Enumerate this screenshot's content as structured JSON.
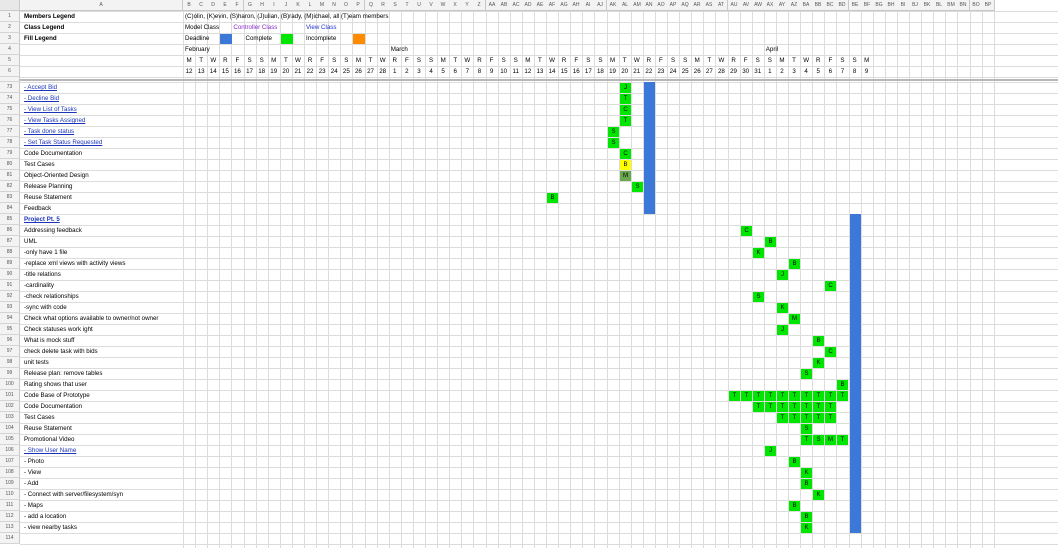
{
  "sheet": {
    "column_headers": [
      "A",
      "B",
      "C",
      "D",
      "E",
      "F",
      "G",
      "H",
      "I",
      "J",
      "K",
      "L",
      "M",
      "N",
      "O",
      "P",
      "Q",
      "R",
      "S",
      "T",
      "U",
      "V",
      "W",
      "X",
      "Y",
      "Z",
      "AA",
      "AB",
      "AC",
      "AD",
      "AE",
      "AF",
      "AG",
      "AH",
      "AI",
      "AJ",
      "AK",
      "AL",
      "AM",
      "AN",
      "AO",
      "AP",
      "AQ",
      "AR",
      "AS",
      "AT",
      "AU",
      "AV",
      "AW",
      "AX",
      "AY",
      "AZ",
      "BA",
      "BB",
      "BC",
      "BD",
      "BE",
      "BF",
      "BG",
      "BH",
      "BI",
      "BJ",
      "BK",
      "BL",
      "BM",
      "BN",
      "BO",
      "BP"
    ],
    "row_numbers": [
      "1",
      "2",
      "3",
      "4",
      "5",
      "6",
      "73",
      "74",
      "75",
      "76",
      "77",
      "78",
      "79",
      "80",
      "81",
      "82",
      "83",
      "84",
      "85",
      "86",
      "87",
      "88",
      "89",
      "90",
      "91",
      "92",
      "93",
      "94",
      "95",
      "96",
      "97",
      "98",
      "99",
      "100",
      "101",
      "102",
      "103",
      "104",
      "105",
      "106",
      "107",
      "108",
      "109",
      "110",
      "111",
      "112",
      "113",
      "114"
    ]
  },
  "legend": {
    "members_label": "Members Legend",
    "members_text": "(C)olin, (K)evin, (S)haron, (J)ulian, (B)rady, (M)ichael, all (T)eam members",
    "class_label": "Class Legend",
    "class_items": [
      "Model Class",
      "Controller Class",
      "View Class"
    ],
    "fill_label": "Fill Legend",
    "fill_items": [
      "Deadline",
      "Complete",
      "Incomplete"
    ]
  },
  "colors": {
    "deadline": "#3c78d8",
    "complete": "#00e600",
    "incomplete": "#ff8c00",
    "yellow": "#ffff00",
    "olive": "#6aa84f"
  },
  "months": [
    "February",
    "March",
    "April"
  ],
  "weekdays": [
    "M",
    "T",
    "W",
    "R",
    "F",
    "S",
    "S",
    "M",
    "T",
    "W",
    "R",
    "F",
    "S",
    "S",
    "M",
    "T",
    "W",
    "R",
    "F",
    "S",
    "S",
    "M",
    "T",
    "W",
    "R",
    "F",
    "S",
    "S",
    "M",
    "T",
    "W",
    "R",
    "F",
    "S",
    "S",
    "M",
    "T",
    "W",
    "R",
    "F",
    "S",
    "S",
    "M",
    "T",
    "W",
    "R",
    "F",
    "S",
    "S",
    "M",
    "T",
    "W",
    "R",
    "F",
    "S",
    "S",
    "M"
  ],
  "dates": [
    "12",
    "13",
    "14",
    "15",
    "16",
    "17",
    "18",
    "19",
    "20",
    "21",
    "22",
    "23",
    "24",
    "25",
    "26",
    "27",
    "28",
    "1",
    "2",
    "3",
    "4",
    "5",
    "6",
    "7",
    "8",
    "9",
    "10",
    "11",
    "12",
    "13",
    "14",
    "15",
    "16",
    "17",
    "18",
    "19",
    "20",
    "21",
    "22",
    "23",
    "24",
    "25",
    "26",
    "27",
    "28",
    "29",
    "30",
    "31",
    "1",
    "2",
    "3",
    "4",
    "5",
    "6",
    "7",
    "8",
    "9"
  ],
  "tasks": [
    "- Accept Bid",
    "- Decline Bid",
    "- View List of Tasks",
    "- View Tasks Assigned",
    "- Task done status",
    "- Set Task Status Requested",
    "Code Documentation",
    "Test Cases",
    "Object-Oriented Design",
    "Release Planning",
    "Reuse Statement",
    "Feedback",
    "Project Pt. 5",
    "Addressing feedback",
    "UML",
    "-only have 1 file",
    "-replace xml views with activity views",
    "-title relations",
    "-cardinality",
    "-check relationships",
    "-sync with code",
    "Check what options available to owner/not owner",
    "Check statuses work ight",
    "What is mock stuff",
    "check delete task with bids",
    "unit tests",
    "Release plan: remove tables",
    "Rating shows that user",
    "Code Base of Prototype",
    "Code Documentation",
    "Test Cases",
    "Reuse Statement",
    "Promotional Video",
    "- Show User Name",
    "- Photo",
    " - View",
    " - Add",
    " - Connect with server/filesystem/syn",
    "- Maps",
    " - add a location",
    " - view nearby tasks",
    ""
  ],
  "link_rows": [
    0,
    1,
    2,
    3,
    4,
    5,
    33
  ],
  "bold_rows": [
    12
  ],
  "assignments": [
    {
      "row": 0,
      "col": 36,
      "letter": "J",
      "fill": "complete"
    },
    {
      "row": 1,
      "col": 36,
      "letter": "T",
      "fill": "complete"
    },
    {
      "row": 2,
      "col": 36,
      "letter": "C",
      "fill": "complete"
    },
    {
      "row": 3,
      "col": 36,
      "letter": "T",
      "fill": "complete"
    },
    {
      "row": 4,
      "col": 35,
      "letter": "S",
      "fill": "complete"
    },
    {
      "row": 5,
      "col": 35,
      "letter": "S",
      "fill": "complete"
    },
    {
      "row": 6,
      "col": 36,
      "letter": "C",
      "fill": "complete"
    },
    {
      "row": 7,
      "col": 36,
      "letter": "B",
      "fill": "yellow"
    },
    {
      "row": 8,
      "col": 36,
      "letter": "M",
      "fill": "olive"
    },
    {
      "row": 9,
      "col": 37,
      "letter": "S",
      "fill": "complete"
    },
    {
      "row": 10,
      "col": 30,
      "letter": "B",
      "fill": "complete"
    },
    {
      "row": 13,
      "col": 46,
      "letter": "C",
      "fill": "complete"
    },
    {
      "row": 14,
      "col": 48,
      "letter": "B",
      "fill": "complete"
    },
    {
      "row": 15,
      "col": 47,
      "letter": "K",
      "fill": "complete"
    },
    {
      "row": 16,
      "col": 50,
      "letter": "B",
      "fill": "complete"
    },
    {
      "row": 17,
      "col": 49,
      "letter": "J",
      "fill": "complete"
    },
    {
      "row": 18,
      "col": 53,
      "letter": "C",
      "fill": "complete"
    },
    {
      "row": 19,
      "col": 47,
      "letter": "S",
      "fill": "complete"
    },
    {
      "row": 20,
      "col": 49,
      "letter": "K",
      "fill": "complete"
    },
    {
      "row": 21,
      "col": 50,
      "letter": "M",
      "fill": "complete"
    },
    {
      "row": 22,
      "col": 49,
      "letter": "J",
      "fill": "complete"
    },
    {
      "row": 23,
      "col": 52,
      "letter": "B",
      "fill": "complete"
    },
    {
      "row": 24,
      "col": 53,
      "letter": "C",
      "fill": "complete"
    },
    {
      "row": 25,
      "col": 52,
      "letter": "K",
      "fill": "complete"
    },
    {
      "row": 26,
      "col": 51,
      "letter": "S",
      "fill": "complete"
    },
    {
      "row": 27,
      "col": 54,
      "letter": "B",
      "fill": "complete"
    },
    {
      "row": 28,
      "col": 45,
      "letter": "T",
      "fill": "complete"
    },
    {
      "row": 28,
      "col": 46,
      "letter": "T",
      "fill": "complete"
    },
    {
      "row": 28,
      "col": 47,
      "letter": "T",
      "fill": "complete"
    },
    {
      "row": 28,
      "col": 48,
      "letter": "T",
      "fill": "complete"
    },
    {
      "row": 28,
      "col": 49,
      "letter": "T",
      "fill": "complete"
    },
    {
      "row": 28,
      "col": 50,
      "letter": "T",
      "fill": "complete"
    },
    {
      "row": 28,
      "col": 51,
      "letter": "T",
      "fill": "complete"
    },
    {
      "row": 28,
      "col": 52,
      "letter": "T",
      "fill": "complete"
    },
    {
      "row": 28,
      "col": 53,
      "letter": "T",
      "fill": "complete"
    },
    {
      "row": 28,
      "col": 54,
      "letter": "T",
      "fill": "complete"
    },
    {
      "row": 29,
      "col": 47,
      "letter": "T",
      "fill": "complete"
    },
    {
      "row": 29,
      "col": 48,
      "letter": "T",
      "fill": "complete"
    },
    {
      "row": 29,
      "col": 49,
      "letter": "T",
      "fill": "complete"
    },
    {
      "row": 29,
      "col": 50,
      "letter": "T",
      "fill": "complete"
    },
    {
      "row": 29,
      "col": 51,
      "letter": "T",
      "fill": "complete"
    },
    {
      "row": 29,
      "col": 52,
      "letter": "T",
      "fill": "complete"
    },
    {
      "row": 29,
      "col": 53,
      "letter": "T",
      "fill": "complete"
    },
    {
      "row": 30,
      "col": 49,
      "letter": "T",
      "fill": "complete"
    },
    {
      "row": 30,
      "col": 50,
      "letter": "T",
      "fill": "complete"
    },
    {
      "row": 30,
      "col": 51,
      "letter": "T",
      "fill": "complete"
    },
    {
      "row": 30,
      "col": 52,
      "letter": "T",
      "fill": "complete"
    },
    {
      "row": 30,
      "col": 53,
      "letter": "T",
      "fill": "complete"
    },
    {
      "row": 31,
      "col": 51,
      "letter": "S",
      "fill": "complete"
    },
    {
      "row": 32,
      "col": 51,
      "letter": "T",
      "fill": "complete"
    },
    {
      "row": 32,
      "col": 52,
      "letter": "S",
      "fill": "complete"
    },
    {
      "row": 32,
      "col": 53,
      "letter": "M",
      "fill": "complete"
    },
    {
      "row": 32,
      "col": 54,
      "letter": "T",
      "fill": "complete"
    },
    {
      "row": 33,
      "col": 48,
      "letter": "J",
      "fill": "complete"
    },
    {
      "row": 34,
      "col": 50,
      "letter": "B",
      "fill": "complete"
    },
    {
      "row": 35,
      "col": 51,
      "letter": "K",
      "fill": "complete"
    },
    {
      "row": 36,
      "col": 51,
      "letter": "B",
      "fill": "complete"
    },
    {
      "row": 37,
      "col": 52,
      "letter": "K",
      "fill": "complete"
    },
    {
      "row": 38,
      "col": 50,
      "letter": "B",
      "fill": "complete"
    },
    {
      "row": 39,
      "col": 51,
      "letter": "B",
      "fill": "complete"
    },
    {
      "row": 40,
      "col": 51,
      "letter": "K",
      "fill": "complete"
    }
  ],
  "deadlines": [
    {
      "col": 38,
      "from_row": 0,
      "to_row": 11
    },
    {
      "col": 55,
      "from_row": 12,
      "to_row": 40
    }
  ]
}
